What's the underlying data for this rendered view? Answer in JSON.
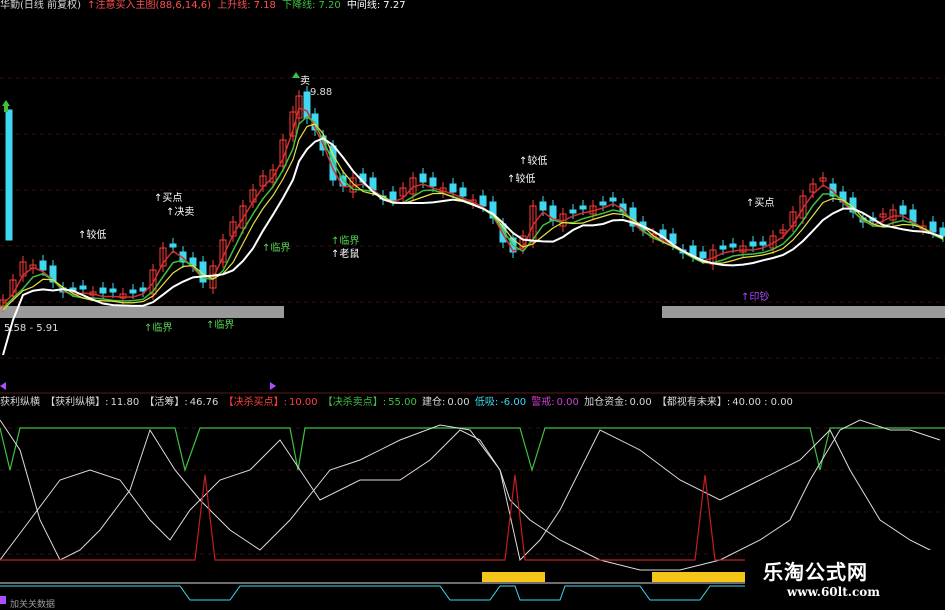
{
  "header": {
    "stock_name": "华勤(日线 前复权)",
    "indicator": "↑注意买入主图(88,6,14,6)",
    "upper_label": "上升线:",
    "upper_value": "7.18",
    "lower_label": "下降线:",
    "lower_value": "7.20",
    "mid_label": "中间线:",
    "mid_value": "7.27"
  },
  "price_annotations": {
    "high_price": "9.88",
    "low_range": "5.58 - 5.91",
    "labels": [
      {
        "text": "↑买点",
        "color": "#ffffff"
      },
      {
        "text": "↑较低",
        "color": "#ffffff"
      },
      {
        "text": "↑决卖",
        "color": "#ffffff"
      },
      {
        "text": "↑临界",
        "color": "#55d455"
      },
      {
        "text": "↑老鼠",
        "color": "#ffffff"
      },
      {
        "text": "↑较低",
        "color": "#ffffff"
      },
      {
        "text": "↑买点",
        "color": "#ffffff"
      },
      {
        "text": "↑印钞",
        "color": "#b04cff"
      }
    ]
  },
  "indicator_header": {
    "name": "获利纵横",
    "p1_label": "【获利纵横】:",
    "p1_value": "11.80",
    "p2_label": "【活筹】:",
    "p2_value": "46.76",
    "p3_label": "【决杀买点】:",
    "p3_value": "10.00",
    "p4_label": "【决杀卖点】:",
    "p4_value": "55.00",
    "p5_label": "建仓:",
    "p5_value": "0.00",
    "p6_label": "低吸:",
    "p6_value": "-6.00",
    "p7_label": "警戒:",
    "p7_value": "0.00",
    "p8_label": "加仓资金:",
    "p8_value": "0.00",
    "p9_label": "【都视有未来】:",
    "p9_value": "40.00 : 0.00"
  },
  "bottom_label": "加关关数据",
  "watermark": {
    "title": "乐淘公式网",
    "url": "www.60lt.com"
  },
  "colors": {
    "up": "#ff3b3b",
    "down": "#3fd8f0",
    "ma_white": "#ffffff",
    "ma_yellow": "#e8e040",
    "ma_green": "#40c040",
    "ma_red": "#d03030",
    "zone_gray": "#9a9a9a",
    "yellow_bar": "#f5c518"
  }
}
